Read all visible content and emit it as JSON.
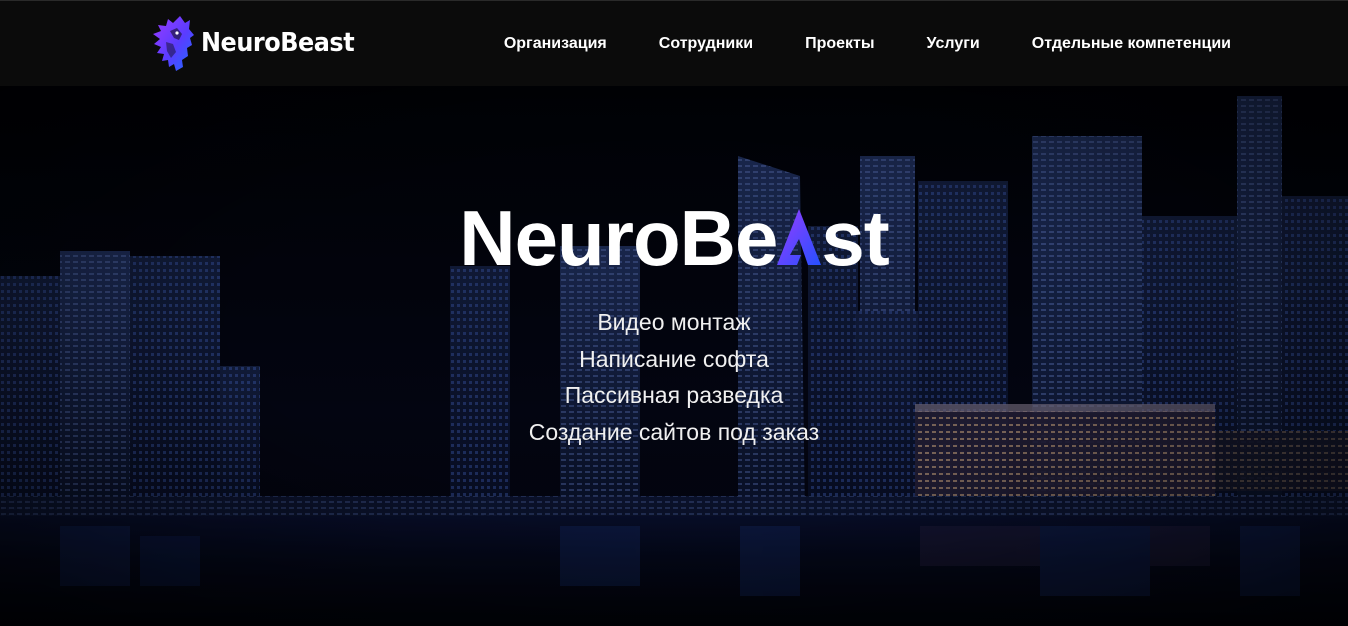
{
  "header": {
    "logo_text": "NeuroBeast",
    "logo_icon": "wolf-icon",
    "nav": [
      {
        "label": "Организация"
      },
      {
        "label": "Сотрудники"
      },
      {
        "label": "Проекты"
      },
      {
        "label": "Услуги"
      },
      {
        "label": "Отдельные компетенции"
      }
    ]
  },
  "hero": {
    "title_before": "NeuroBe",
    "title_after": "st",
    "title_accent_letter": "A",
    "services": [
      "Видео монтаж",
      "Написание софта",
      "Пассивная разведка",
      "Создание сайтов под заказ"
    ]
  },
  "colors": {
    "header_bg": "#0b0b0b",
    "text": "#ffffff",
    "accent_purple": "#7a2cff",
    "accent_blue": "#2a55ff",
    "hero_bg": "#02030a"
  }
}
